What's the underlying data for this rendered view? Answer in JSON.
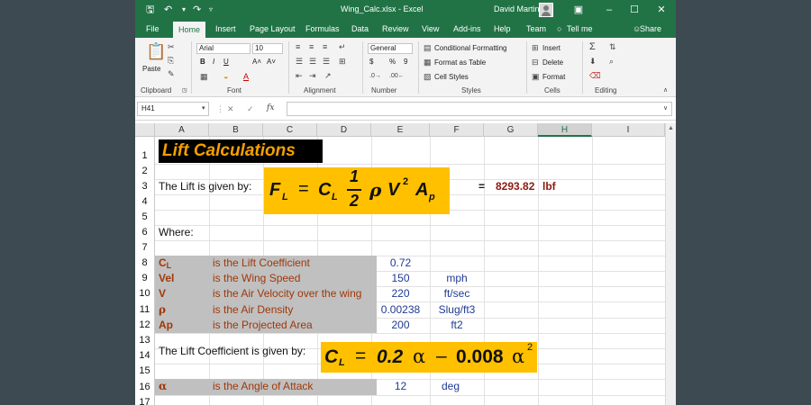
{
  "window": {
    "title": "Wing_Calc.xlsx  -  Excel",
    "user": "David Martin",
    "qa_icons": [
      "save-icon",
      "undo-icon",
      "redo-icon",
      "customize-icon"
    ]
  },
  "menu": [
    "File",
    "Home",
    "Insert",
    "Page Layout",
    "Formulas",
    "Data",
    "Review",
    "View",
    "Add-ins",
    "Help",
    "Team",
    "Tell me",
    "Share"
  ],
  "ribbon": {
    "groups": [
      "Clipboard",
      "Font",
      "Alignment",
      "Number",
      "Styles",
      "Cells",
      "Editing"
    ],
    "paste_label": "Paste",
    "font_name": "Arial",
    "font_size": "10",
    "bold": "B",
    "italic": "I",
    "underline": "U",
    "grow_font": "A˄",
    "shrink_font": "A˅",
    "number_format": "General",
    "currency": "$",
    "percent": "%",
    "comma": "9",
    "conditional_formatting": "Conditional Formatting",
    "format_as_table": "Format as Table",
    "cell_styles": "Cell Styles",
    "insert": "Insert",
    "delete": "Delete",
    "format": "Format"
  },
  "formula_bar": {
    "name_box": "H41",
    "fx": "fx",
    "cancel": "✕",
    "enter": "✓"
  },
  "columns": [
    "A",
    "B",
    "C",
    "D",
    "E",
    "F",
    "G",
    "H",
    "I"
  ],
  "rows": [
    "1",
    "2",
    "3",
    "4",
    "5",
    "6",
    "7",
    "8",
    "9",
    "10",
    "11",
    "12",
    "13",
    "14",
    "15",
    "16",
    "17"
  ],
  "sheet": {
    "title": "Lift Calculations",
    "lift_given_by": "The Lift is given by:",
    "lift_equals": "=",
    "lift_value": "8293.82",
    "lift_unit": "lbf",
    "where": "Where:",
    "variables": [
      {
        "symbol": "C",
        "sub": "L",
        "desc": "is the Lift Coefficient",
        "value": "0.72",
        "unit": ""
      },
      {
        "symbol": "Vel",
        "sub": "",
        "desc": "is the Wing Speed",
        "value": "150",
        "unit": "mph"
      },
      {
        "symbol": "V",
        "sub": "",
        "desc": "is the Air Velocity over the wing",
        "value": "220",
        "unit": "ft/sec"
      },
      {
        "symbol": "ρ",
        "sub": "",
        "desc": "is the Air Density",
        "value": "0.00238",
        "unit": "Slug/ft3"
      },
      {
        "symbol": "Ap",
        "sub": "",
        "desc": "is the Projected Area",
        "value": "200",
        "unit": "ft2"
      }
    ],
    "coef_given_by": "The Lift Coefficient is given by:",
    "alpha": {
      "symbol": "α",
      "desc": "is the Angle of Attack",
      "value": "12",
      "unit": "deg"
    },
    "equation1": {
      "F": "F",
      "F_sub": "L",
      "eq": "=",
      "C": "C",
      "C_sub": "L",
      "num": "1",
      "den": "2",
      "rho": "ρ",
      "V": "V",
      "V_sup": "2",
      "A": "A",
      "A_sub": "p"
    },
    "equation2": {
      "C": "C",
      "C_sub": "L",
      "eq": "=",
      "k1": "0.2",
      "a1": "α",
      "minus": "–",
      "k2": "0.008",
      "a2": "α",
      "a2_sup": "2"
    }
  }
}
